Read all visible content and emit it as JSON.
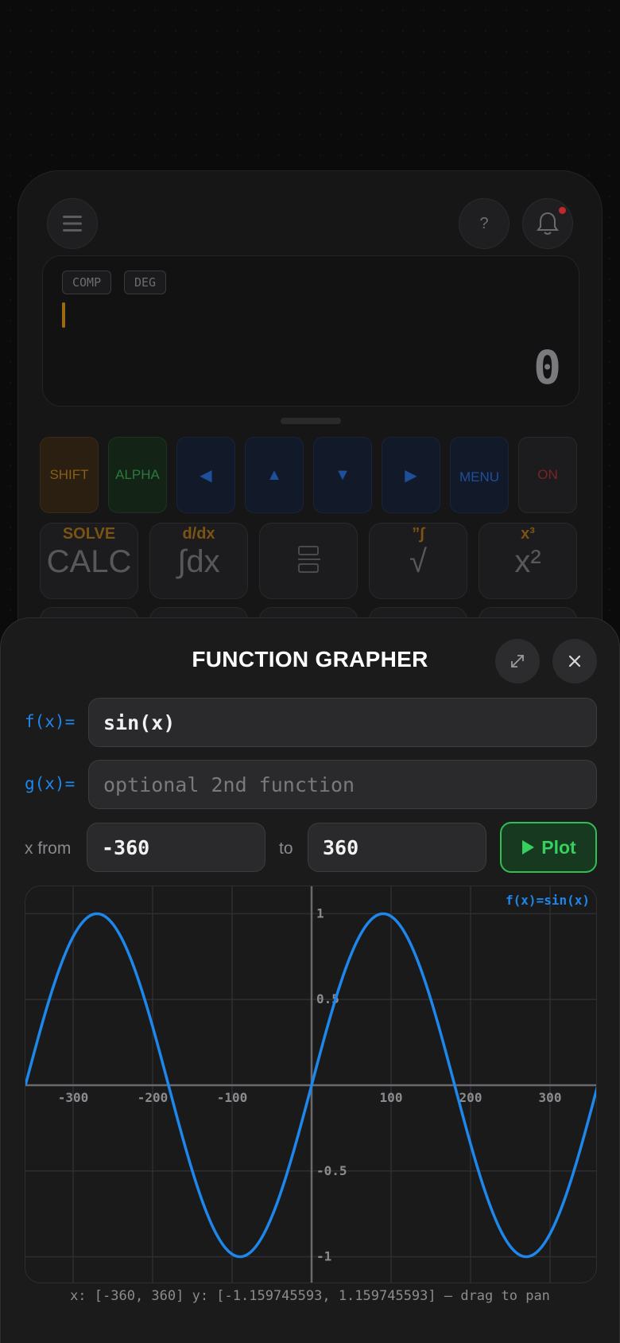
{
  "calculator": {
    "help_label": "?",
    "mode_tags": [
      "COMP",
      "DEG"
    ],
    "display_value": "0",
    "top_keys": [
      {
        "label": "SHIFT",
        "kind": "shift"
      },
      {
        "label": "ALPHA",
        "kind": "alpha"
      },
      {
        "label": "◀",
        "kind": "nav"
      },
      {
        "label": "▲",
        "kind": "nav"
      },
      {
        "label": "▼",
        "kind": "nav"
      },
      {
        "label": "▶",
        "kind": "nav"
      },
      {
        "label": "MENU",
        "kind": "menu"
      },
      {
        "label": "ON",
        "kind": "on"
      }
    ],
    "func_keys": [
      {
        "shift": "SOLVE",
        "main": "CALC"
      },
      {
        "shift": "d/dx",
        "main": "∫dx"
      },
      {
        "shift": "",
        "main": ""
      },
      {
        "shift": "”∫",
        "main": "√"
      },
      {
        "shift": "x³",
        "main": "x²"
      }
    ]
  },
  "grapher": {
    "title": "FUNCTION GRAPHER",
    "f_label": "f(x)=",
    "f_value": "sin(x)",
    "g_label": "g(x)=",
    "g_value": "",
    "g_placeholder": "optional 2nd function",
    "x_from_label": "x from",
    "x_from_value": "-360",
    "to_label": "to",
    "x_to_value": "360",
    "plot_label": "Plot",
    "legend": "f(x)=sin(x)",
    "status": "x: [-360, 360] y: [-1.159745593, 1.159745593] — drag to pan",
    "colors": {
      "curve": "#1e87ec",
      "plot_accent": "#2fbf55"
    }
  },
  "chart_data": {
    "type": "line",
    "series": [
      {
        "name": "f(x)=sin(x)",
        "function": "sin(x)",
        "angle_unit": "deg",
        "color": "#1e87ec"
      }
    ],
    "xlim": [
      -360,
      360
    ],
    "ylim": [
      -1.159745593,
      1.159745593
    ],
    "x_ticks": [
      -300,
      -200,
      -100,
      100,
      200,
      300
    ],
    "y_ticks": [
      1,
      0.5,
      -0.5,
      -1
    ],
    "y_tick_labels": [
      "1",
      "0.5",
      "-0.5",
      "-1"
    ],
    "grid": true,
    "legend_position": "top-right"
  }
}
